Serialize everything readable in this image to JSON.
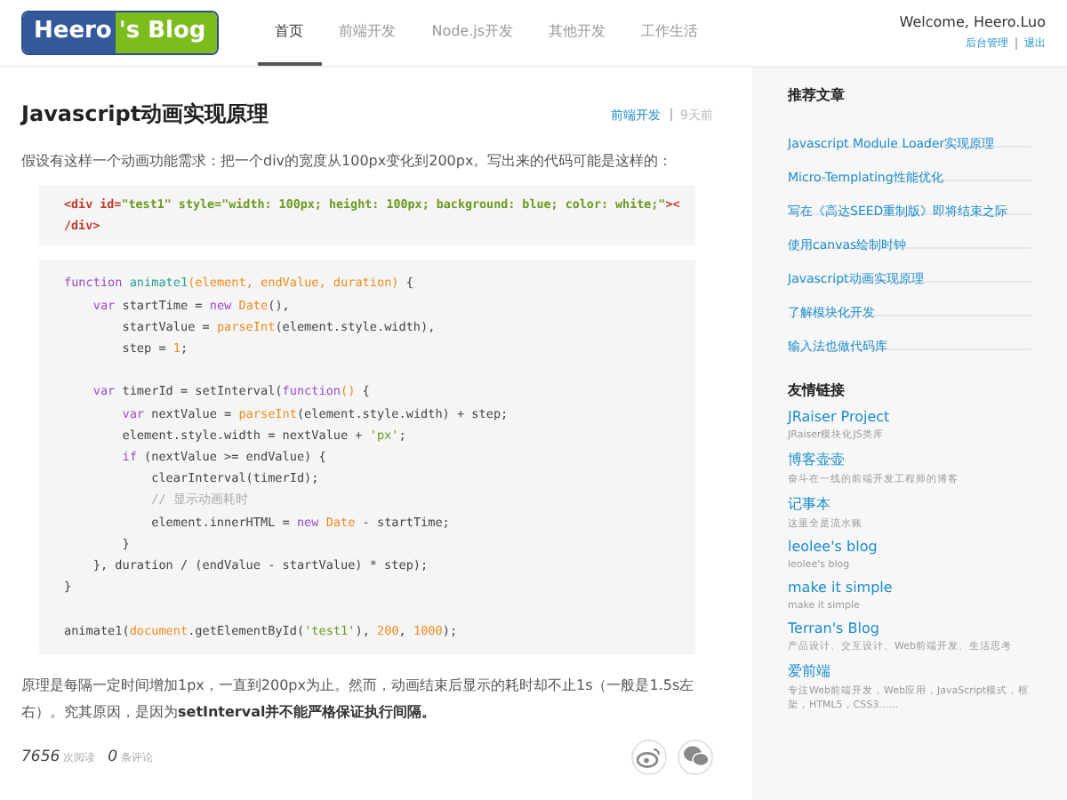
{
  "header": {
    "logo": {
      "part1": "Heero",
      "part2": "'s Blog"
    },
    "nav": [
      {
        "label": "首页",
        "selected": true
      },
      {
        "label": "前端开发",
        "selected": false
      },
      {
        "label": "Node.js开发",
        "selected": false
      },
      {
        "label": "其他开发",
        "selected": false
      },
      {
        "label": "工作生活",
        "selected": false
      }
    ],
    "welcome": "Welcome, Heero.Luo",
    "links": [
      "后台管理",
      "退出"
    ]
  },
  "article": {
    "title": "Javascript动画实现原理",
    "category": "前端开发",
    "age": "9天前",
    "intro": "假设有这样一个动画功能需求：把一个div的宽度从100px变化到200px。写出来的代码可能是这样的：",
    "code_blocks": [
      {
        "bold": true,
        "sections": [
          [
            [
              {
                "text": "<div id=",
                "color": "#c0392b"
              },
              {
                "text": "\"test1\" style=\"width: 100px; height: 100px; background: blue; color: white;\"",
                "color": "#6a9a1f"
              },
              {
                "text": "><",
                "color": "#c0392b"
              }
            ],
            [
              {
                "text": "/div>",
                "color": "#c0392b"
              }
            ]
          ]
        ]
      },
      {
        "bold": false,
        "sections": [
          [
            [
              {
                "text": "function ",
                "color": "#9b4dca"
              },
              {
                "text": "animate1",
                "color": "#2aa198"
              },
              {
                "text": "(element, endValue, duration)",
                "color": "#f08c1e"
              },
              {
                "text": " {"
              }
            ],
            [
              {
                "text": "    var",
                "color": "#9b4dca"
              },
              {
                "text": " startTime = "
              },
              {
                "text": "new ",
                "color": "#9b4dca"
              },
              {
                "text": "Date",
                "color": "#f08c1e"
              },
              {
                "text": "(),"
              }
            ],
            [
              {
                "text": "        startValue = "
              },
              {
                "text": "parseInt",
                "color": "#f08c1e"
              },
              {
                "text": "(element.style.width),"
              }
            ],
            [
              {
                "text": "        step = "
              },
              {
                "text": "1",
                "color": "#f08c1e"
              },
              {
                "text": ";"
              }
            ]
          ],
          [
            [
              {
                "text": "    var",
                "color": "#9b4dca"
              },
              {
                "text": " timerId = setInterval("
              },
              {
                "text": "function",
                "color": "#9b4dca"
              },
              {
                "text": "()",
                "color": "#f08c1e"
              },
              {
                "text": " {"
              }
            ],
            [
              {
                "text": "        var",
                "color": "#9b4dca"
              },
              {
                "text": " nextValue = "
              },
              {
                "text": "parseInt",
                "color": "#f08c1e"
              },
              {
                "text": "(element.style.width) + step;"
              }
            ],
            [
              {
                "text": "        element.style.width = nextValue + "
              },
              {
                "text": "'px'",
                "color": "#6a9a1f"
              },
              {
                "text": ";"
              }
            ],
            [
              {
                "text": "        if",
                "color": "#9b4dca"
              },
              {
                "text": " (nextValue >= endValue) {"
              }
            ],
            [
              {
                "text": "            clearInterval(timerId);"
              }
            ],
            [
              {
                "text": "            // 显示动画耗时",
                "color": "#aaaaaa"
              }
            ],
            [
              {
                "text": "            element.innerHTML = "
              },
              {
                "text": "new ",
                "color": "#9b4dca"
              },
              {
                "text": "Date",
                "color": "#f08c1e"
              },
              {
                "text": " - startTime;"
              }
            ],
            [
              {
                "text": "        }"
              }
            ],
            [
              {
                "text": "    }, duration / (endValue - startValue) * step);"
              }
            ],
            [
              {
                "text": "}"
              }
            ]
          ],
          [
            [
              {
                "text": "animate1("
              },
              {
                "text": "document",
                "color": "#f08c1e"
              },
              {
                "text": ".getElementById("
              },
              {
                "text": "'test1'",
                "color": "#6a9a1f"
              },
              {
                "text": "), "
              },
              {
                "text": "200",
                "color": "#f08c1e"
              },
              {
                "text": ", "
              },
              {
                "text": "1000",
                "color": "#f08c1e"
              },
              {
                "text": ");"
              }
            ]
          ]
        ]
      }
    ],
    "conclusion": "原理是每隔一定时间增加1px，一直到200px为止。然而，动画结束后显示的耗时却不止1s（一般是1.5s左右）。究其原因，是因为**setInterval并不能严格保证执行间隔。**",
    "stats": {
      "reads": "7656",
      "reads_label": "次阅读",
      "comments": "0",
      "comments_label": "条评论"
    }
  },
  "sidebar": {
    "recommended_title": "推荐文章",
    "recommended": [
      "Javascript Module Loader实现原理",
      "Micro-Templating性能优化",
      "写在《高达SEED重制版》即将结束之际",
      "使用canvas绘制时钟",
      "Javascript动画实现原理",
      "了解模块化开发",
      "输入法也做代码库"
    ],
    "links_title": "友情链接",
    "links": [
      {
        "name": "JRaiser Project",
        "desc": "JRaiser模块化JS类库"
      },
      {
        "name": "博客壶壶",
        "desc": "奋斗在一线的前端开发工程师的博客"
      },
      {
        "name": "记事本",
        "desc": "这里全是流水账"
      },
      {
        "name": "leolee's blog",
        "desc": "leolee's blog"
      },
      {
        "name": "make it simple",
        "desc": "make it simple"
      },
      {
        "name": "Terran's Blog",
        "desc": "产品设计、交互设计、Web前端开发、生活思考"
      },
      {
        "name": "爱前端",
        "desc": "专注Web前端开发，Web应用，JavaScript模式，框架，HTML5，CSS3……"
      }
    ]
  }
}
